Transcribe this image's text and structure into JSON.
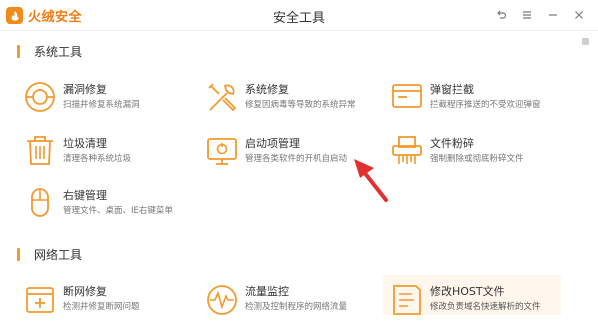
{
  "app": {
    "logo_text": "火绒安全",
    "window_title": "安全工具"
  },
  "sections": {
    "system": {
      "title": "系统工具",
      "tools": [
        {
          "name": "漏洞修复",
          "desc": "扫描并修复系统漏洞",
          "icon": "vulnerability-repair-icon"
        },
        {
          "name": "系统修复",
          "desc": "修复因病毒等导致的系统异常",
          "icon": "system-repair-icon"
        },
        {
          "name": "弹窗拦截",
          "desc": "拦截程序推送的不受欢迎弹窗",
          "icon": "popup-block-icon"
        },
        {
          "name": "垃圾清理",
          "desc": "清理各种系统垃圾",
          "icon": "trash-cleanup-icon"
        },
        {
          "name": "启动项管理",
          "desc": "管理各类软件的开机自启动",
          "icon": "startup-manager-icon"
        },
        {
          "name": "文件粉碎",
          "desc": "强制删除或彻底粉碎文件",
          "icon": "file-shredder-icon"
        },
        {
          "name": "右键管理",
          "desc": "管理文件、桌面、IE右键菜单",
          "icon": "context-menu-icon"
        }
      ]
    },
    "network": {
      "title": "网络工具",
      "tools": [
        {
          "name": "断网修复",
          "desc": "检测并修复断网问题",
          "icon": "network-repair-icon"
        },
        {
          "name": "流量监控",
          "desc": "检测及控制程序的网络流量",
          "icon": "traffic-monitor-icon"
        },
        {
          "name": "修改HOST文件",
          "desc": "修改负责域名快速解析的文件",
          "icon": "host-file-icon"
        }
      ]
    }
  },
  "colors": {
    "accent": "#f39a2c",
    "arrow": "#e03030",
    "highlight_bg": "#fff7ee"
  }
}
